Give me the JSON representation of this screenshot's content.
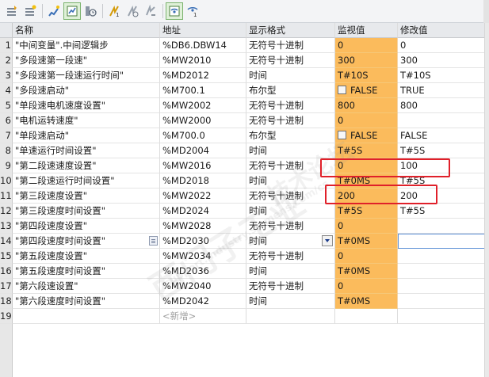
{
  "headers": {
    "num": "",
    "name": "名称",
    "address": "地址",
    "format": "显示格式",
    "monitor": "监视值",
    "modify": "修改值"
  },
  "rows": [
    {
      "num": "1",
      "name": "\"中间变量\".中间逻辑步",
      "address": "%DB6.DBW14",
      "format": "无符号十进制",
      "monitor": "0",
      "modify": "0"
    },
    {
      "num": "2",
      "name": "\"多段速第一段速\"",
      "address": "%MW2010",
      "format": "无符号十进制",
      "monitor": "300",
      "modify": "300"
    },
    {
      "num": "3",
      "name": "\"多段速第一段速运行时间\"",
      "address": "%MD2012",
      "format": "时间",
      "monitor": "T#10S",
      "modify": "T#10S"
    },
    {
      "num": "4",
      "name": "\"多段速启动\"",
      "address": "%M700.1",
      "format": "布尔型",
      "monitor": "FALSE",
      "modify": "TRUE"
    },
    {
      "num": "5",
      "name": "\"单段速电机速度设置\"",
      "address": "%MW2002",
      "format": "无符号十进制",
      "monitor": "800",
      "modify": "800"
    },
    {
      "num": "6",
      "name": "\"电机运转速度\"",
      "address": "%MW2000",
      "format": "无符号十进制",
      "monitor": "0",
      "modify": ""
    },
    {
      "num": "7",
      "name": "\"单段速启动\"",
      "address": "%M700.0",
      "format": "布尔型",
      "monitor": "FALSE",
      "modify": "FALSE"
    },
    {
      "num": "8",
      "name": "\"单速运行时间设置\"",
      "address": "%MD2004",
      "format": "时间",
      "monitor": "T#5S",
      "modify": "T#5S"
    },
    {
      "num": "9",
      "name": "\"第二段速速度设置\"",
      "address": "%MW2016",
      "format": "无符号十进制",
      "monitor": "0",
      "modify": "100"
    },
    {
      "num": "10",
      "name": "\"第二段速运行时间设置\"",
      "address": "%MD2018",
      "format": "时间",
      "monitor": "T#0MS",
      "modify": "T#5S"
    },
    {
      "num": "11",
      "name": "\"第三段速度设置\"",
      "address": "%MW2022",
      "format": "无符号十进制",
      "monitor": "200",
      "modify": "200"
    },
    {
      "num": "12",
      "name": "\"第三段速度时间设置\"",
      "address": "%MD2024",
      "format": "时间",
      "monitor": "T#5S",
      "modify": "T#5S"
    },
    {
      "num": "13",
      "name": "\"第四段速度设置\"",
      "address": "%MW2028",
      "format": "无符号十进制",
      "monitor": "0",
      "modify": ""
    },
    {
      "num": "14",
      "name": "\"第四段速度时间设置\"",
      "address": "%MD2030",
      "format": "时间",
      "monitor": "T#0MS",
      "modify": ""
    },
    {
      "num": "15",
      "name": "\"第五段速度设置\"",
      "address": "%MW2034",
      "format": "无符号十进制",
      "monitor": "0",
      "modify": ""
    },
    {
      "num": "16",
      "name": "\"第五段速度时间设置\"",
      "address": "%MD2036",
      "format": "时间",
      "monitor": "T#0MS",
      "modify": ""
    },
    {
      "num": "17",
      "name": "\"第六段速设置\"",
      "address": "%MW2040",
      "format": "无符号十进制",
      "monitor": "0",
      "modify": ""
    },
    {
      "num": "18",
      "name": "\"第六段速度时间设置\"",
      "address": "%MD2042",
      "format": "时间",
      "monitor": "T#0MS",
      "modify": ""
    }
  ],
  "new_row": {
    "num": "19",
    "address_placeholder": "<新增>"
  },
  "watermark": {
    "line1": "西门子工业",
    "line2": "support.industry.siemens.com/cs",
    "line3": "技术论坛"
  },
  "colors": {
    "monitor_bg": "#fbbb5c",
    "highlight": "#e0202a",
    "toolbar_active": "#dff0d8"
  },
  "toolbar_icons": [
    "insert-row-icon",
    "add-row-icon",
    "monitor-once-icon",
    "monitor-all-icon",
    "show-hide-icon",
    "modify-now-icon",
    "modify-trigger-icon",
    "enable-peripheral-icon",
    "show-addresses-icon",
    "show-modify-column-icon"
  ]
}
